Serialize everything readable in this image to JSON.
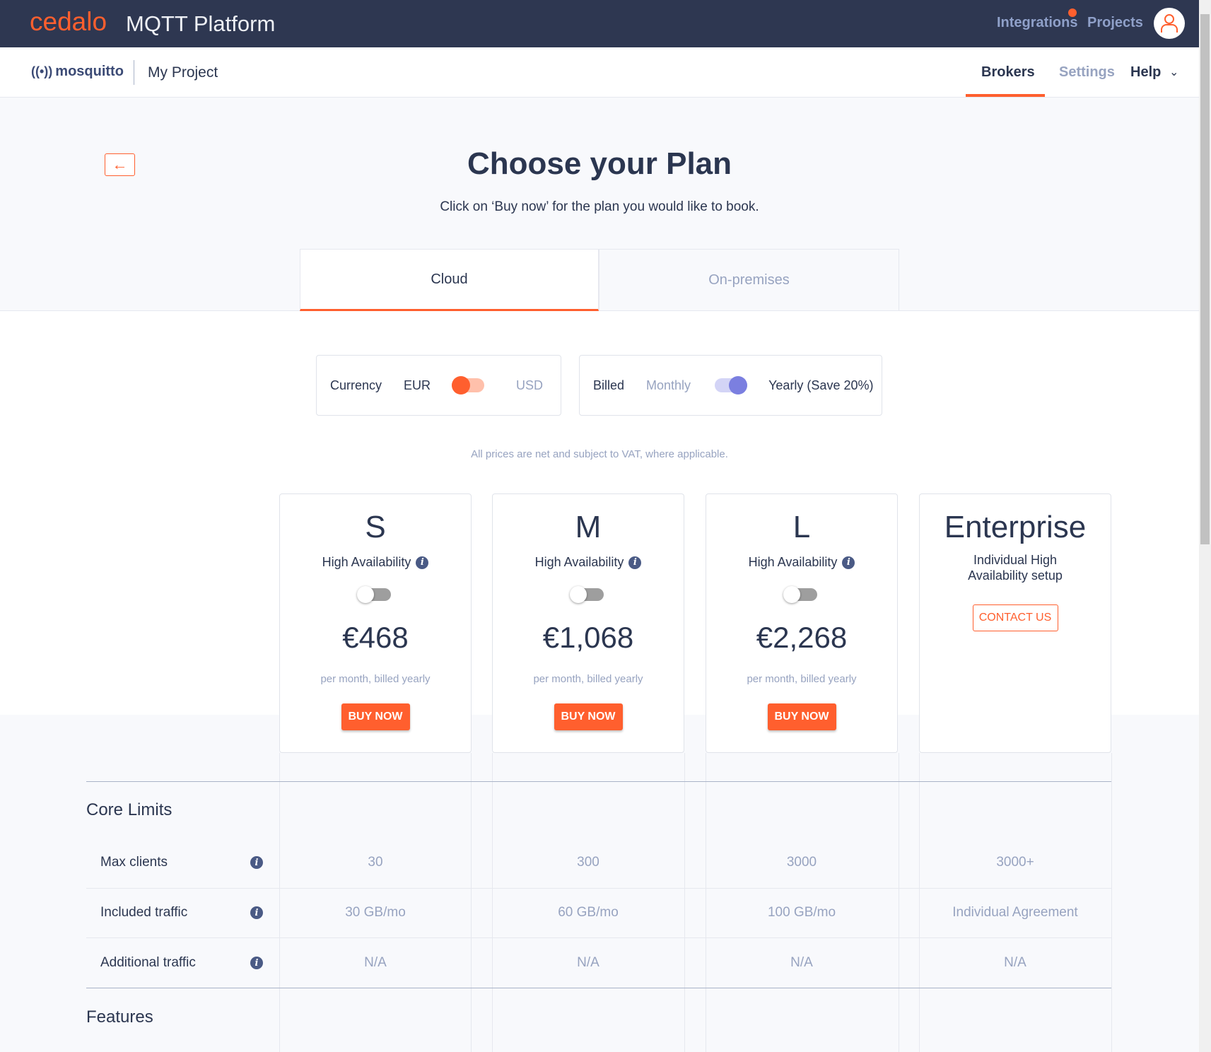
{
  "header": {
    "brand": "cedalo",
    "product": "MQTT Platform",
    "nav": [
      "Integrations",
      "Projects"
    ],
    "notification_color": "#ff5f2e"
  },
  "subnav": {
    "logo": "mosquitto",
    "project": "My Project",
    "tabs": [
      "Brokers",
      "Settings",
      "Help"
    ],
    "active": "Brokers"
  },
  "page": {
    "title": "Choose your Plan",
    "subtitle": "Click on ‘Buy now’ for the plan you would like to book.",
    "tabs": [
      "Cloud",
      "On-premises"
    ],
    "active_tab": "Cloud"
  },
  "currency": {
    "label": "Currency",
    "left": "EUR",
    "right": "USD",
    "selected": "EUR"
  },
  "billing": {
    "label": "Billed",
    "left": "Monthly",
    "right": "Yearly (Save 20%)",
    "selected": "Yearly (Save 20%)"
  },
  "vat_note": "All prices are net and subject to VAT, where applicable.",
  "plans": [
    {
      "name": "S",
      "ha": "High Availability",
      "ha_on": false,
      "price": "€468",
      "period": "per month, billed yearly",
      "button": "BUY NOW"
    },
    {
      "name": "M",
      "ha": "High Availability",
      "ha_on": false,
      "price": "€1,068",
      "period": "per month, billed yearly",
      "button": "BUY NOW"
    },
    {
      "name": "L",
      "ha": "High Availability",
      "ha_on": false,
      "price": "€2,268",
      "period": "per month, billed yearly",
      "button": "BUY NOW"
    },
    {
      "name": "Enterprise",
      "desc": "Individual High Availability setup",
      "button": "CONTACT US"
    }
  ],
  "core_limits": {
    "title": "Core Limits",
    "rows": [
      {
        "label": "Max clients",
        "values": [
          "30",
          "300",
          "3000",
          "3000+"
        ]
      },
      {
        "label": "Included traffic",
        "values": [
          "30 GB/mo",
          "60 GB/mo",
          "100 GB/mo",
          "Individual Agreement"
        ]
      },
      {
        "label": "Additional traffic",
        "values": [
          "N/A",
          "N/A",
          "N/A",
          "N/A"
        ]
      }
    ]
  },
  "features": {
    "title": "Features"
  },
  "colors": {
    "accent": "#ff5f2e",
    "nav_bg": "#2e3751",
    "toggle_billing": "#7b7fe0"
  }
}
